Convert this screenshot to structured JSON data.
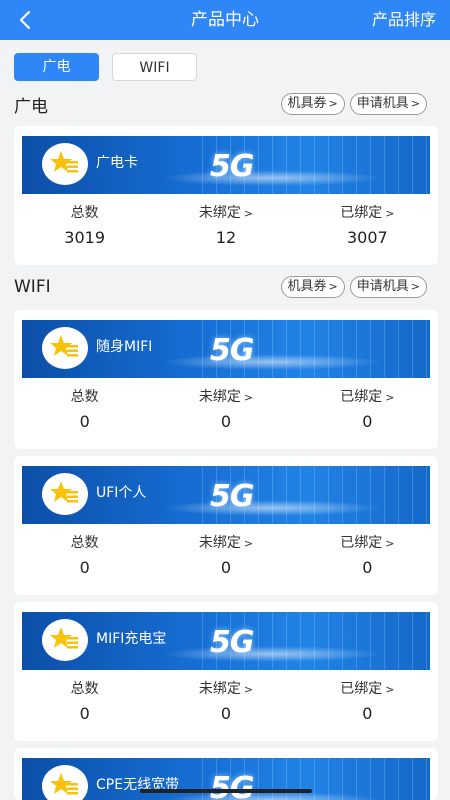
{
  "header": {
    "title": "产品中心",
    "sort_label": "产品排序"
  },
  "tabs": [
    {
      "label": "广电",
      "active": true
    },
    {
      "label": "WIFI",
      "active": false
    }
  ],
  "stat_labels": {
    "total": "总数",
    "unbound": "未绑定",
    "bound": "已绑定"
  },
  "sections": [
    {
      "title": "广电",
      "actions": [
        "机具券",
        "申请机具"
      ],
      "cards": [
        {
          "name": "广电卡",
          "badge": "5G",
          "total": "3019",
          "unbound": "12",
          "bound": "3007"
        }
      ]
    },
    {
      "title": "WIFI",
      "actions": [
        "机具券",
        "申请机具"
      ],
      "cards": [
        {
          "name": "随身MIFI",
          "badge": "5G",
          "total": "0",
          "unbound": "0",
          "bound": "0"
        },
        {
          "name": "UFI个人",
          "badge": "5G",
          "total": "0",
          "unbound": "0",
          "bound": "0"
        },
        {
          "name": "MIFI充电宝",
          "badge": "5G",
          "total": "0",
          "unbound": "0",
          "bound": "0"
        },
        {
          "name": "CPE无线宽带",
          "badge": "5G"
        }
      ]
    }
  ],
  "colors": {
    "primary": "#2f86f6",
    "background": "#f2f3f5",
    "logo_yellow": "#f6c20a"
  }
}
